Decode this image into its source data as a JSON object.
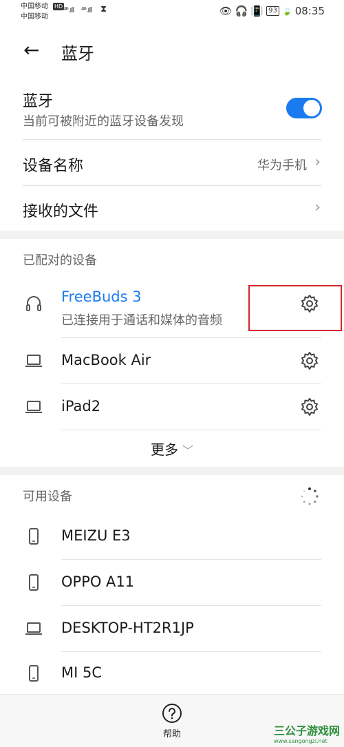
{
  "status_bar": {
    "carrier1": "中国移动",
    "carrier2": "中国移动",
    "hd": "HD",
    "sig1": "⁴⁶.ıll",
    "sig2": "⁴⁶.ıll",
    "hourglass": "⧗",
    "battery": "93",
    "time": "08:35"
  },
  "header": {
    "title": "蓝牙"
  },
  "bluetooth": {
    "title": "蓝牙",
    "subtitle": "当前可被附近的蓝牙设备发现",
    "enabled": true
  },
  "device_name": {
    "label": "设备名称",
    "value": "华为手机"
  },
  "received_files": {
    "label": "接收的文件"
  },
  "paired": {
    "section_title": "已配对的设备",
    "devices": [
      {
        "name": "FreeBuds 3",
        "status": "已连接用于通话和媒体的音频",
        "icon": "headphones-icon"
      },
      {
        "name": "MacBook Air",
        "icon": "laptop-icon"
      },
      {
        "name": "iPad2",
        "icon": "laptop-icon"
      }
    ],
    "more_label": "更多"
  },
  "available": {
    "section_title": "可用设备",
    "devices": [
      {
        "name": "MEIZU E3",
        "icon": "phone-icon"
      },
      {
        "name": "OPPO A11",
        "icon": "phone-icon"
      },
      {
        "name": "DESKTOP-HT2R1JP",
        "icon": "laptop-icon"
      },
      {
        "name": "MI 5C",
        "icon": "phone-icon"
      }
    ]
  },
  "bottom": {
    "help_label": "帮助"
  },
  "watermark": {
    "main": "三公子游戏网",
    "sub": "www.sangongzi.net"
  },
  "colors": {
    "accent": "#1a7bf0",
    "highlight": "#d6262c"
  }
}
